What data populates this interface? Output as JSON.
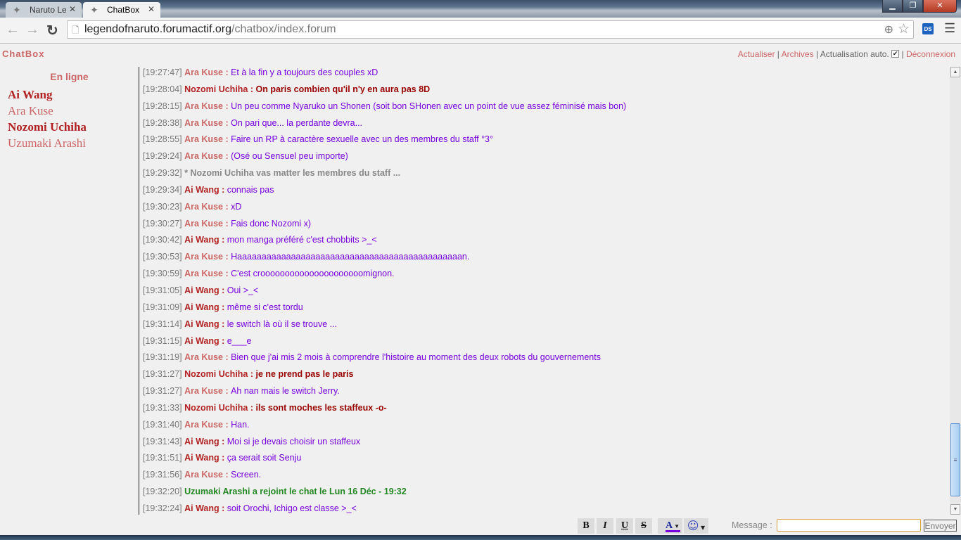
{
  "browser": {
    "tabs": [
      {
        "label": "Naruto Le",
        "active": false
      },
      {
        "label": "ChatBox",
        "active": true
      }
    ],
    "url_host": "legendofnaruto.forumactif.org",
    "url_path": "/chatbox/index.forum",
    "extension_label": "DS"
  },
  "header": {
    "title": "ChatBox",
    "links": {
      "refresh": "Actualiser",
      "archives": "Archives",
      "auto_refresh": "Actualisation auto.",
      "auto_refresh_checked": true,
      "logout": "Déconnexion"
    }
  },
  "sidebar": {
    "title": "En ligne",
    "users": [
      {
        "name": "Ai Wang",
        "bold": true,
        "color": "#b22222"
      },
      {
        "name": "Ara Kuse",
        "bold": false,
        "color": "#cc6666"
      },
      {
        "name": "Nozomi Uchiha",
        "bold": true,
        "color": "#b22222"
      },
      {
        "name": "Uzumaki Arashi",
        "bold": false,
        "color": "#cc6666"
      }
    ]
  },
  "colors": {
    "ara": "#cc6666",
    "ai": "#b22222",
    "nozomi": "#b22222",
    "message": "#7700dd",
    "join": "#228822",
    "accent": "#cc6666"
  },
  "messages": [
    {
      "time": "[19:27:47]",
      "user": "Ara Kuse",
      "type": "normal",
      "text": "Et à la fin y a toujours des couples xD"
    },
    {
      "time": "[19:28:04]",
      "user": "Nozomi Uchiha",
      "type": "nozomi",
      "text": "On paris combien qu'il n'y en aura pas 8D"
    },
    {
      "time": "[19:28:15]",
      "user": "Ara Kuse",
      "type": "normal",
      "text": "Un peu comme Nyaruko un Shonen (soit bon SHonen avec un point de vue assez féminisé mais bon)"
    },
    {
      "time": "[19:28:38]",
      "user": "Ara Kuse",
      "type": "normal",
      "text": "On pari que... la perdante devra..."
    },
    {
      "time": "[19:28:55]",
      "user": "Ara Kuse",
      "type": "normal",
      "text": "Faire un RP à caractère sexuelle avec un des membres du staff °3°"
    },
    {
      "time": "[19:29:24]",
      "user": "Ara Kuse",
      "type": "normal",
      "text": "(Osé ou Sensuel peu importe)"
    },
    {
      "time": "[19:29:32]",
      "user": "",
      "type": "action",
      "text": "* Nozomi Uchiha vas matter les membres du staff ..."
    },
    {
      "time": "[19:29:34]",
      "user": "Ai Wang",
      "type": "normal",
      "text": "connais pas"
    },
    {
      "time": "[19:30:23]",
      "user": "Ara Kuse",
      "type": "normal",
      "text": "xD"
    },
    {
      "time": "[19:30:27]",
      "user": "Ara Kuse",
      "type": "normal",
      "text": "Fais donc Nozomi x)"
    },
    {
      "time": "[19:30:42]",
      "user": "Ai Wang",
      "type": "normal",
      "text": "mon manga préféré c'est chobbits >_<"
    },
    {
      "time": "[19:30:53]",
      "user": "Ara Kuse",
      "type": "normal",
      "text": "Haaaaaaaaaaaaaaaaaaaaaaaaaaaaaaaaaaaaaaaaaaaaaan."
    },
    {
      "time": "[19:30:59]",
      "user": "Ara Kuse",
      "type": "normal",
      "text": "C'est crooooooooooooooooooooomignon."
    },
    {
      "time": "[19:31:05]",
      "user": "Ai Wang",
      "type": "normal",
      "text": "Oui >_<"
    },
    {
      "time": "[19:31:09]",
      "user": "Ai Wang",
      "type": "normal",
      "text": "même si c'est tordu"
    },
    {
      "time": "[19:31:14]",
      "user": "Ai Wang",
      "type": "normal",
      "text": "le switch là où il se trouve ..."
    },
    {
      "time": "[19:31:15]",
      "user": "Ai Wang",
      "type": "normal",
      "text": "e___e"
    },
    {
      "time": "[19:31:19]",
      "user": "Ara Kuse",
      "type": "normal",
      "text": "Bien que j'ai mis 2 mois à comprendre l'histoire au moment des deux robots du gouvernements"
    },
    {
      "time": "[19:31:27]",
      "user": "Nozomi Uchiha",
      "type": "nozomi",
      "text": "je ne prend pas le paris"
    },
    {
      "time": "[19:31:27]",
      "user": "Ara Kuse",
      "type": "normal",
      "text": "Ah nan mais le switch Jerry."
    },
    {
      "time": "[19:31:33]",
      "user": "Nozomi Uchiha",
      "type": "nozomi",
      "text": "ils sont moches les staffeux -o-"
    },
    {
      "time": "[19:31:40]",
      "user": "Ara Kuse",
      "type": "normal",
      "text": "Han."
    },
    {
      "time": "[19:31:43]",
      "user": "Ai Wang",
      "type": "normal",
      "text": "Moi si je devais choisir un staffeux"
    },
    {
      "time": "[19:31:51]",
      "user": "Ai Wang",
      "type": "normal",
      "text": "ça serait soit Senju"
    },
    {
      "time": "[19:31:56]",
      "user": "Ara Kuse",
      "type": "normal",
      "text": "Screen."
    },
    {
      "time": "[19:32:20]",
      "user": "",
      "type": "join",
      "text": "Uzumaki Arashi a rejoint le chat le Lun 16 Déc - 19:32"
    },
    {
      "time": "[19:32:24]",
      "user": "Ai Wang",
      "type": "normal",
      "text": "soit Orochi, Ichigo est classe >_<"
    }
  ],
  "composer": {
    "format_buttons": [
      "B",
      "I",
      "U",
      "S"
    ],
    "color_button": "A",
    "color_value": "#7700dd",
    "message_label": "Message :",
    "message_value": "",
    "send_label": "Envoyer"
  },
  "scroll_position_percent": 100
}
